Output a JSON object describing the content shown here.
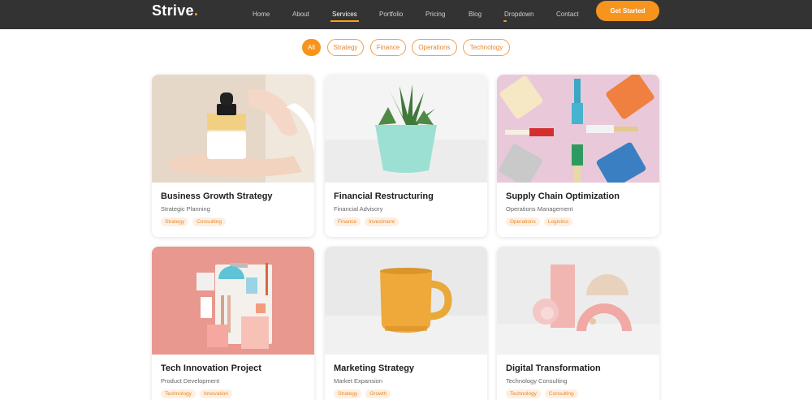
{
  "header": {
    "logo": "Strive",
    "logo_dot": ".",
    "nav": [
      "Home",
      "About",
      "Services",
      "Portfolio",
      "Pricing",
      "Blog",
      "Dropdown",
      "Contact"
    ],
    "active_nav": "Services",
    "cta_label": "Get Started",
    "accent_color": "#f7941d"
  },
  "filters": {
    "items": [
      "All",
      "Strategy",
      "Finance",
      "Operations",
      "Technology"
    ],
    "active": "All"
  },
  "cards": [
    {
      "title": "Business Growth Strategy",
      "subtitle": "Strategic Planning",
      "tags": [
        "Strategy",
        "Consulting"
      ],
      "image": "serum-bottle-in-hand"
    },
    {
      "title": "Financial Restructuring",
      "subtitle": "Financial Advisory",
      "tags": [
        "Finance",
        "Investment"
      ],
      "image": "succulent-in-teal-pot"
    },
    {
      "title": "Supply Chain Optimization",
      "subtitle": "Operations Management",
      "tags": [
        "Operations",
        "Logistics"
      ],
      "image": "paint-cans-and-brushes"
    },
    {
      "title": "Tech Innovation Project",
      "subtitle": "Product Development",
      "tags": [
        "Technology",
        "Innovation"
      ],
      "image": "stationery-flat-lay"
    },
    {
      "title": "Marketing Strategy",
      "subtitle": "Market Expansion",
      "tags": [
        "Strategy",
        "Growth"
      ],
      "image": "yellow-mug"
    },
    {
      "title": "Digital Transformation",
      "subtitle": "Technology Consulting",
      "tags": [
        "Technology",
        "Consulting"
      ],
      "image": "pink-geometric-shapes"
    }
  ]
}
